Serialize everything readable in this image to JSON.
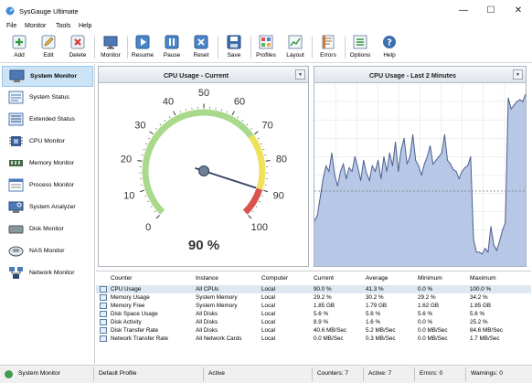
{
  "window": {
    "title": "SysGauge Ultimate",
    "controls": [
      "—",
      "☐",
      "✕"
    ]
  },
  "menu": [
    "File",
    "Monitor",
    "Tools",
    "Help"
  ],
  "toolbar": {
    "buttons": [
      {
        "label": "Add",
        "icon": "add-icon"
      },
      {
        "label": "Edit",
        "icon": "edit-icon"
      },
      {
        "label": "Delete",
        "icon": "delete-icon"
      },
      {
        "label": "Monitor",
        "icon": "monitor-icon"
      },
      {
        "label": "Resume",
        "icon": "play-icon"
      },
      {
        "label": "Pause",
        "icon": "pause-icon"
      },
      {
        "label": "Reset",
        "icon": "reset-icon"
      },
      {
        "label": "Save",
        "icon": "save-icon"
      },
      {
        "label": "Profiles",
        "icon": "profiles-icon"
      },
      {
        "label": "Layout",
        "icon": "layout-icon"
      },
      {
        "label": "Errors",
        "icon": "errors-icon"
      },
      {
        "label": "Options",
        "icon": "options-icon"
      },
      {
        "label": "Help",
        "icon": "help-icon"
      }
    ]
  },
  "sidebar": {
    "items": [
      {
        "label": "System Monitor",
        "icon": "system-monitor-icon",
        "active": true
      },
      {
        "label": "System Status",
        "icon": "system-status-icon"
      },
      {
        "label": "Extended Status",
        "icon": "extended-status-icon"
      },
      {
        "label": "CPU Monitor",
        "icon": "cpu-icon"
      },
      {
        "label": "Memory Monitor",
        "icon": "memory-icon"
      },
      {
        "label": "Process Monitor",
        "icon": "process-icon"
      },
      {
        "label": "System Analyzer",
        "icon": "analyzer-icon"
      },
      {
        "label": "Disk Monitor",
        "icon": "disk-icon"
      },
      {
        "label": "NAS Monitor",
        "icon": "nas-icon"
      },
      {
        "label": "Network Monitor",
        "icon": "network-icon"
      }
    ]
  },
  "gauge": {
    "title": "CPU Usage - Current",
    "value_percent": 90,
    "readout": "90 %",
    "scale_min": 0,
    "scale_max": 100,
    "tick_labels": [
      "0",
      "10",
      "20",
      "30",
      "40",
      "50",
      "60",
      "70",
      "80",
      "90",
      "100"
    ],
    "zone_colors": {
      "low": "#a9d98a",
      "mid": "#eee25a",
      "high": "#d9534f"
    }
  },
  "history": {
    "title": "CPU Usage - Last 2 Minutes",
    "fill_color": "#b7c7e6",
    "line_color": "#4c5f8e"
  },
  "chart_data": {
    "type": "area",
    "title": "CPU Usage - Last 2 Minutes",
    "ylim": [
      0,
      100
    ],
    "grid": true,
    "average_line": 41.3,
    "values": [
      25,
      28,
      38,
      48,
      55,
      52,
      62,
      50,
      44,
      52,
      56,
      48,
      54,
      52,
      60,
      54,
      47,
      58,
      51,
      47,
      55,
      52,
      58,
      48,
      60,
      52,
      62,
      55,
      68,
      52,
      64,
      70,
      56,
      60,
      72,
      58,
      55,
      50,
      56,
      60,
      66,
      56,
      58,
      60,
      62,
      72,
      58,
      56,
      53,
      52,
      48,
      52,
      54,
      55,
      60,
      15,
      8,
      8,
      7,
      10,
      8,
      22,
      12,
      9,
      14,
      20,
      24,
      92,
      86,
      88,
      90,
      91,
      90,
      94
    ]
  },
  "table": {
    "columns": [
      "Counter",
      "Instance",
      "Computer",
      "Current",
      "Average",
      "Minimum",
      "Maximum"
    ],
    "rows": [
      [
        "CPU Usage",
        "All CPUs",
        "Local",
        "90.0 %",
        "41.3 %",
        "0.0 %",
        "100.0 %"
      ],
      [
        "Memory Usage",
        "System Memory",
        "Local",
        "29.2 %",
        "30.2 %",
        "29.2 %",
        "34.2 %"
      ],
      [
        "Memory Free",
        "System Memory",
        "Local",
        "1.85 GB",
        "1.79 GB",
        "1.62 GB",
        "1.85 GB"
      ],
      [
        "Disk Space Usage",
        "All Disks",
        "Local",
        "5.6 %",
        "5.6 %",
        "5.6 %",
        "5.6 %"
      ],
      [
        "Disk Activity",
        "All Disks",
        "Local",
        "8.9 %",
        "1.6 %",
        "0.0 %",
        "25.2 %"
      ],
      [
        "Disk Transfer Rate",
        "All Disks",
        "Local",
        "40.6 MB/Sec",
        "5.2 MB/Sec",
        "0.0 MB/Sec",
        "84.6 MB/Sec"
      ],
      [
        "Network Transfer Rate",
        "All Network Cards",
        "Local",
        "0.0 MB/Sec",
        "0.3 MB/Sec",
        "0.0 MB/Sec",
        "1.7 MB/Sec"
      ]
    ]
  },
  "status": {
    "monitor": "System Monitor",
    "profile": "Default Profile",
    "state": "Active",
    "counters": "Counters: 7",
    "active": "Active: 7",
    "errors": "Errors: 0",
    "warnings": "Warnings: 0"
  }
}
